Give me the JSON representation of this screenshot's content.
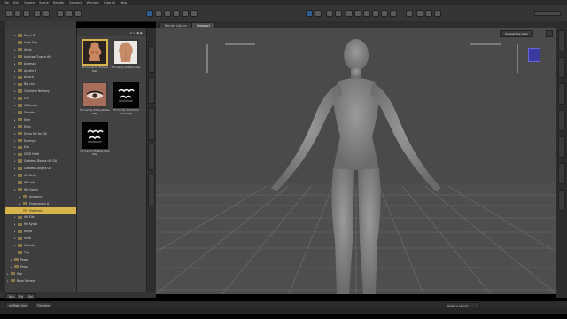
{
  "menu": [
    "File",
    "Edit",
    "Create",
    "Scene",
    "Render",
    "Connect",
    "Window",
    "Tutorial",
    "Help"
  ],
  "viewport_tabs": [
    "Render Library",
    "Viewport"
  ],
  "viewport": {
    "camera_label": "Perspective View"
  },
  "library": {
    "items": [
      {
        "label": "Aery HD",
        "depth": 1
      },
      {
        "label": "Addy Eve",
        "depth": 1
      },
      {
        "label": "Alicia",
        "depth": 1
      },
      {
        "label": "Anaïsse Chopra HD",
        "depth": 1
      },
      {
        "label": "Aneesah",
        "depth": 1
      },
      {
        "label": "Aurelie 8",
        "depth": 1
      },
      {
        "label": "Aurora",
        "depth": 1
      },
      {
        "label": "Big Lou",
        "depth": 1
      },
      {
        "label": "Charlotte Brittany",
        "depth": 1
      },
      {
        "label": "Cici",
        "depth": 1
      },
      {
        "label": "CJ Electra",
        "depth": 1
      },
      {
        "label": "Dorotha",
        "depth": 1
      },
      {
        "label": "Edie",
        "depth": 1
      },
      {
        "label": "Elani",
        "depth": 1
      },
      {
        "label": "Elena HD for G8",
        "depth": 1
      },
      {
        "label": "Emersyn",
        "depth": 1
      },
      {
        "label": "Eva",
        "depth": 1
      },
      {
        "label": "GWD Heidi",
        "depth": 1
      },
      {
        "label": "Goddess Blanca HD G8",
        "depth": 1
      },
      {
        "label": "Goddess Angels G8",
        "depth": 1
      },
      {
        "label": "HD Bella",
        "depth": 1
      },
      {
        "label": "HD Lexi",
        "depth": 1
      },
      {
        "label": "HD Candy",
        "depth": 1
      },
      {
        "label": "Anatomy",
        "depth": 2
      },
      {
        "label": "Expressions 8",
        "depth": 2
      },
      {
        "label": "Materials",
        "depth": 2,
        "selected": true
      },
      {
        "label": "HD Elle",
        "depth": 1
      },
      {
        "label": "HD Kyoko",
        "depth": 1
      },
      {
        "label": "Katya",
        "depth": 1
      },
      {
        "label": "Mora",
        "depth": 1
      },
      {
        "label": "Ophelia",
        "depth": 1
      },
      {
        "label": "Tilly",
        "depth": 1
      },
      {
        "label": "Poses",
        "depth": 0
      },
      {
        "label": "Props",
        "depth": 0
      },
      {
        "label": "Hair",
        "depth": -1
      },
      {
        "label": "Base Female",
        "depth": -1
      }
    ]
  },
  "thumbnails": {
    "page": "1 of 1",
    "items": [
      {
        "label": "HD Candy 01 Female Map",
        "kind": "torso-female"
      },
      {
        "label": "HD Candy 02 Male Map",
        "kind": "torso-male"
      },
      {
        "label": "HD Candy 03 Eyelashes Map",
        "kind": "eye"
      },
      {
        "label": "HD Candy 04 Female Dots Map",
        "kind": "logo"
      },
      {
        "label": "HD Candy 05 Male Dots Map",
        "kind": "logo"
      }
    ]
  },
  "bottom_tabs": [
    "Nav",
    "Ed",
    "Sel"
  ],
  "lower_tabs": [
    "aniMate Lite",
    "Timeline"
  ],
  "status": {
    "layout_select": "Select a Layout"
  },
  "colors": {
    "selection": "#d8b54a",
    "viewport_bg": "#4a4a4a",
    "grid": "#6e6e6e"
  }
}
